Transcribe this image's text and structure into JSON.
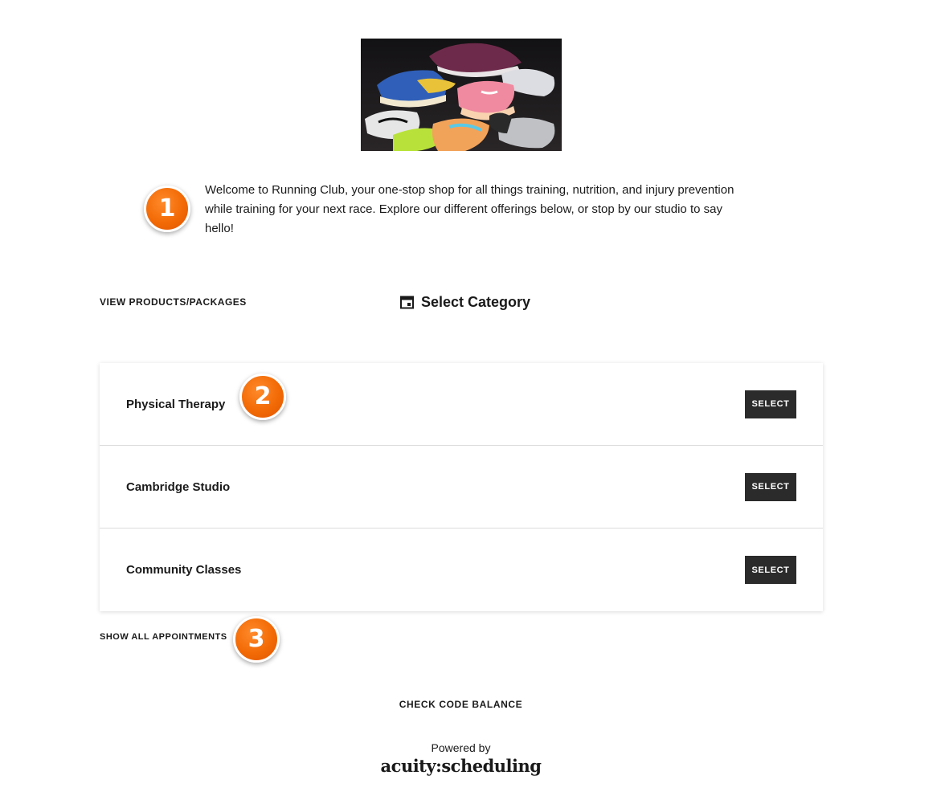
{
  "hero": {
    "image_icon": "running-shoes-photo"
  },
  "markers": {
    "one": "1",
    "two": "2",
    "three": "3"
  },
  "intro": {
    "text": "Welcome to Running Club, your one-stop shop for all things training, nutrition, and injury prevention while training for your next race. Explore our different offerings below, or stop by our studio to say hello!"
  },
  "nav": {
    "view_products": "VIEW PRODUCTS/PACKAGES",
    "category_title": "Select Category",
    "category_icon": "calendar-icon"
  },
  "categories": [
    {
      "name": "Physical Therapy",
      "button": "SELECT"
    },
    {
      "name": "Cambridge Studio",
      "button": "SELECT"
    },
    {
      "name": "Community Classes",
      "button": "SELECT"
    }
  ],
  "footer": {
    "show_all": "SHOW ALL APPOINTMENTS",
    "check_code": "CHECK CODE BALANCE",
    "powered_by": "Powered by",
    "brand": "acuity:scheduling"
  },
  "colors": {
    "button_bg": "#2b2b2b",
    "marker_orange": "#f26a06",
    "text": "#1a1a1a"
  }
}
